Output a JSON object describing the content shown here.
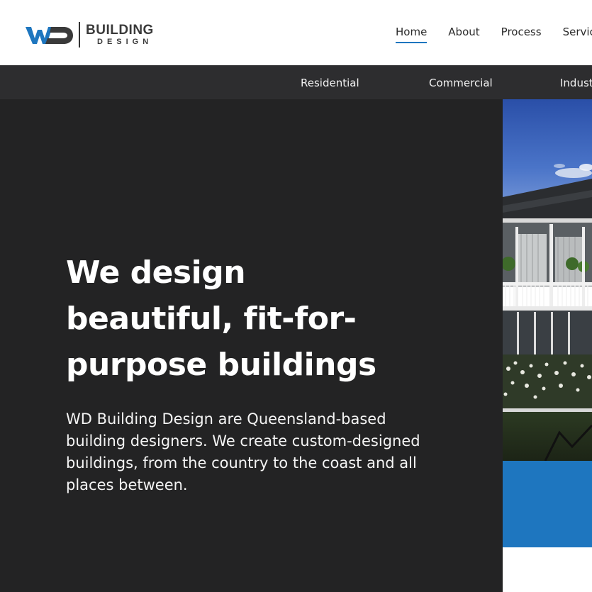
{
  "brand": {
    "logo_letters": "WD",
    "name_line1": "BUILDING",
    "name_line2": "DESIGN",
    "colors": {
      "blue": "#1e76bf",
      "dark": "#3a3a3a"
    }
  },
  "nav": {
    "items": [
      {
        "label": "Home",
        "active": true
      },
      {
        "label": "About",
        "active": false
      },
      {
        "label": "Process",
        "active": false
      },
      {
        "label": "Services",
        "active": false
      }
    ]
  },
  "subnav": {
    "items": [
      {
        "label": "Residential"
      },
      {
        "label": "Commercial"
      },
      {
        "label": "Industrial"
      }
    ]
  },
  "hero": {
    "title": "We design beautiful, fit-for-purpose buildings",
    "text": "WD Building Design are Queensland-based building designers. We create custom-designed buildings, from the country to the coast and all places between."
  },
  "colors": {
    "hero_bg": "#232324",
    "subnav_bg": "#2d2d2f",
    "accent": "#1e76bf"
  }
}
